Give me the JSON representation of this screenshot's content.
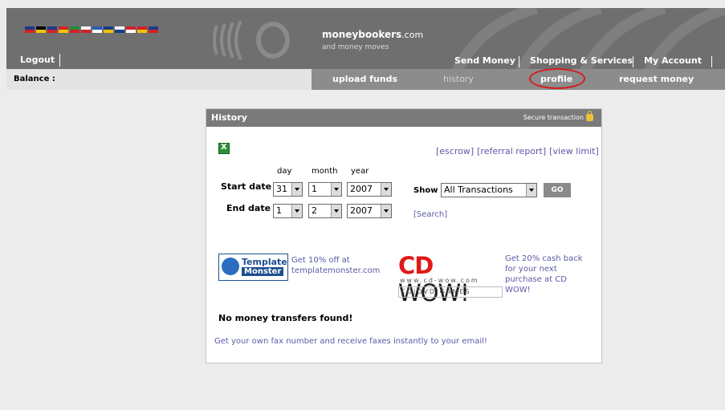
{
  "header": {
    "brand_name": "moneybookers",
    "brand_tld": ".com",
    "tagline": "and money moves",
    "logout": "Logout",
    "flags": [
      {
        "name": "uk-flag",
        "c1": "#1b3a8a",
        "c2": "#d51f26"
      },
      {
        "name": "de-flag",
        "c1": "#000000",
        "c2": "#f5c400"
      },
      {
        "name": "fr-flag",
        "c1": "#1b3a8a",
        "c2": "#d51f26"
      },
      {
        "name": "es-flag",
        "c1": "#d51f26",
        "c2": "#f5c400"
      },
      {
        "name": "it-flag",
        "c1": "#1e8c3a",
        "c2": "#d51f26"
      },
      {
        "name": "pl-flag",
        "c1": "#ffffff",
        "c2": "#d51f26"
      },
      {
        "name": "gr-flag",
        "c1": "#2a5db0",
        "c2": "#ffffff"
      },
      {
        "name": "ro-flag",
        "c1": "#1b3a8a",
        "c2": "#f5c400"
      },
      {
        "name": "ru-flag",
        "c1": "#ffffff",
        "c2": "#1b3a8a"
      },
      {
        "name": "tr-flag",
        "c1": "#d51f26",
        "c2": "#ffffff"
      },
      {
        "name": "cn-flag",
        "c1": "#d51f26",
        "c2": "#f5c400"
      },
      {
        "name": "cz-flag",
        "c1": "#1b3a8a",
        "c2": "#d51f26"
      }
    ],
    "nav": {
      "send_money": "Send Money",
      "shopping": "Shopping & Services",
      "my_account": "My Account"
    }
  },
  "subnav": {
    "balance": "Balance :",
    "upload_funds": "upload funds",
    "history": "history",
    "profile": "profile",
    "request_money": "request money"
  },
  "panel": {
    "title": "History",
    "secure": "Secure transaction",
    "links": {
      "escrow": "[escrow]",
      "referral": "[referral report]",
      "view_limit": "[view limit]"
    },
    "labels": {
      "day": "day",
      "month": "month",
      "year": "year",
      "start_date": "Start date",
      "end_date": "End date",
      "show": "Show"
    },
    "start": {
      "day": "31",
      "month": "1",
      "year": "2007"
    },
    "end": {
      "day": "1",
      "month": "2",
      "year": "2007"
    },
    "show_value": "All Transactions",
    "go": "GO",
    "search": "[Search]",
    "ads": {
      "tm_logo_1": "Template",
      "tm_logo_2": "Monster",
      "tm_text_1": "Get 10% off at",
      "tm_text_2": "templatemonster.com",
      "cd_cd": "CD",
      "cd_wow": " WOW!",
      "cd_url": "www.cd-wow.com",
      "cd_bar": "CD|DVD|GAMES",
      "cd_text": "Get 20% cash back for your next purchase at CD WOW!"
    },
    "no_transfers": "No money transfers found!",
    "fax": "Get your own fax number and receive faxes instantly to your email!"
  }
}
